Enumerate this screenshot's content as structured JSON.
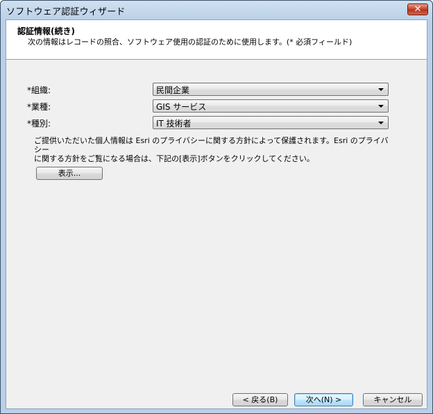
{
  "window": {
    "title": "ソフトウェア認証ウィザード",
    "close_label": "✕"
  },
  "header": {
    "title": "認証情報(続き)",
    "subtitle": "次の情報はレコードの照合、ソフトウェア使用の認証のために使用します。(* 必須フィールド)"
  },
  "form": {
    "organization": {
      "label": "*組織:",
      "value": "民間企業"
    },
    "industry": {
      "label": "*業種:",
      "value": "GIS サービス"
    },
    "role": {
      "label": "*種別:",
      "value": "IT 技術者"
    }
  },
  "privacy": {
    "line1": "ご提供いただいた個人情報は Esri のプライバシーに関する方針によって保護されます。Esri のプライバシー",
    "line2": "に関する方針をご覧になる場合は、下記の[表示]ボタンをクリックしてください。",
    "view_button": "表示..."
  },
  "footer": {
    "back_button": "< 戻る(B)",
    "next_button": "次へ(N) >",
    "cancel_button": "キャンセル"
  }
}
